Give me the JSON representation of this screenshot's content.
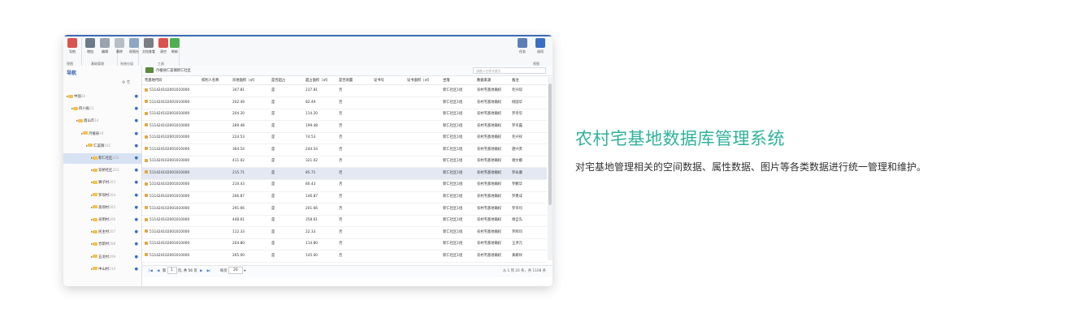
{
  "ribbon": {
    "buttons": [
      {
        "label": "导航",
        "color": "#d9534f"
      },
      {
        "label": "增加",
        "color": "#6c7a8c"
      },
      {
        "label": "编辑",
        "color": "#9aa3ad"
      },
      {
        "label": "删除",
        "color": "#b7bec6"
      },
      {
        "label": "权限社",
        "color": "#8ea6c4"
      },
      {
        "label": "文档查看",
        "color": "#7a7f86"
      },
      {
        "label": "清空",
        "color": "#d9534f"
      },
      {
        "label": "刷新",
        "color": "#4caf50"
      },
      {
        "label": "任务",
        "color": "#5b7fb5"
      },
      {
        "label": "选项",
        "color": "#3b6fc4"
      }
    ],
    "groups": [
      "视图",
      "基础管理",
      "系统分组",
      "工具",
      "视图"
    ]
  },
  "nav": {
    "title": "导航",
    "tree": [
      {
        "label": "中国",
        "count": "34",
        "depth": 0
      },
      {
        "label": "四川省",
        "count": "51",
        "depth": 1
      },
      {
        "label": "眉山市",
        "count": "14",
        "depth": 2
      },
      {
        "label": "丹棱县",
        "count": "24",
        "depth": 3
      },
      {
        "label": "仁美镇",
        "count": "102",
        "depth": 4
      },
      {
        "label": "新仁社区",
        "count": "202",
        "depth": 5,
        "selected": true
      },
      {
        "label": "双桥社区",
        "count": "203",
        "depth": 5
      },
      {
        "label": "狮子村",
        "count": "203",
        "depth": 5
      },
      {
        "label": "罗坝村",
        "count": "204",
        "depth": 5
      },
      {
        "label": "高坝村",
        "count": "205",
        "depth": 5
      },
      {
        "label": "光明村",
        "count": "206",
        "depth": 5
      },
      {
        "label": "民主村",
        "count": "207",
        "depth": 5
      },
      {
        "label": "合新村",
        "count": "208",
        "depth": 5
      },
      {
        "label": "五龙村",
        "count": "209",
        "depth": 5
      },
      {
        "label": "中山村",
        "count": "210",
        "depth": 5
      }
    ]
  },
  "tab": {
    "label": "丹棱县仁美镇新仁社区",
    "search_placeholder": "请输入名称关键字"
  },
  "grid": {
    "headers": [
      "宅基地代码",
      "权利人名称",
      "宗地面积（㎡）",
      "是否超占",
      "超占面积（㎡）",
      "是否闲置",
      "证书号",
      "证书面积（㎡）",
      "坐落",
      "数据来源",
      "备注"
    ],
    "rows": [
      {
        "code": "511424102001010000",
        "area": "347.81",
        "over": "是",
        "over_area": "237.81",
        "idle": "否",
        "loc": "新仁社区1组",
        "src": "农村宅基地确权",
        "note": "毛兴琼"
      },
      {
        "code": "511424102001010000",
        "area": "202.49",
        "over": "是",
        "over_area": "82.49",
        "idle": "否",
        "loc": "新仁社区1组",
        "src": "农村宅基地确权",
        "note": "杨国华"
      },
      {
        "code": "511424102001010000",
        "area": "204.20",
        "over": "是",
        "over_area": "114.20",
        "idle": "否",
        "loc": "新仁社区1组",
        "src": "农村宅基地确权",
        "note": "罗幸华"
      },
      {
        "code": "511424102001010000",
        "area": "289.48",
        "over": "是",
        "over_area": "199.48",
        "idle": "否",
        "loc": "新仁社区1组",
        "src": "农村宅基地确权",
        "note": "罗幸露"
      },
      {
        "code": "511424102001010000",
        "area": "224.53",
        "over": "是",
        "over_area": "74.53",
        "idle": "否",
        "loc": "新仁社区1组",
        "src": "农村宅基地确权",
        "note": "毛兴祥"
      },
      {
        "code": "511424102001010000",
        "area": "364.54",
        "over": "是",
        "over_area": "244.54",
        "idle": "否",
        "loc": "新仁社区1组",
        "src": "农村宅基地确权",
        "note": "唐兴贵"
      },
      {
        "code": "511424102001010000",
        "area": "411.02",
        "over": "是",
        "over_area": "321.02",
        "idle": "否",
        "loc": "新仁社区1组",
        "src": "农村宅基地确权",
        "note": "谢文娥"
      },
      {
        "code": "511424102001010000",
        "area": "215.71",
        "over": "是",
        "over_area": "85.71",
        "idle": "否",
        "loc": "新仁社区1组",
        "src": "农村宅基地确权",
        "note": "罗永康",
        "selected": true
      },
      {
        "code": "511424102001010000",
        "area": "210.43",
        "over": "是",
        "over_area": "80.43",
        "idle": "否",
        "loc": "新仁社区1组",
        "src": "农村宅基地确权",
        "note": "罗鹏华"
      },
      {
        "code": "511424102001010000",
        "area": "266.87",
        "over": "是",
        "over_area": "146.87",
        "idle": "否",
        "loc": "新仁社区1组",
        "src": "农村宅基地确权",
        "note": "罗勇成"
      },
      {
        "code": "511424102001010000",
        "area": "291.66",
        "over": "是",
        "over_area": "201.66",
        "idle": "否",
        "loc": "新仁社区1组",
        "src": "农村宅基地确权",
        "note": "罗幸均"
      },
      {
        "code": "511424102001010000",
        "area": "448.61",
        "over": "是",
        "over_area": "358.61",
        "idle": "否",
        "loc": "新仁社区1组",
        "src": "农村宅基地确权",
        "note": "谢自先"
      },
      {
        "code": "511424102001010000",
        "area": "112.33",
        "over": "是",
        "over_area": "22.33",
        "idle": "否",
        "loc": "新仁社区1组",
        "src": "农村宅基地确权",
        "note": "罗辉均"
      },
      {
        "code": "511424102001010000",
        "area": "204.80",
        "over": "是",
        "over_area": "114.80",
        "idle": "否",
        "loc": "新仁社区1组",
        "src": "农村宅基地确权",
        "note": "王洪元"
      },
      {
        "code": "511424102001010000",
        "area": "265.00",
        "over": "是",
        "over_area": "145.00",
        "idle": "否",
        "loc": "新仁社区1组",
        "src": "农村宅基地确权",
        "note": "黄耕祥"
      }
    ]
  },
  "pager": {
    "page": "1",
    "total_text": "页, 共 56 页",
    "page_size_label": "每页",
    "page_size": "20",
    "summary": "从 1 到 20 条，共 1108 条"
  },
  "heading": {
    "title": "农村宅基地数据库管理系统",
    "description": "对宅基地管理相关的空间数据、属性数据、图片等各类数据进行统一管理和维护。"
  },
  "colors": {
    "accent": "#2fb29a",
    "brand": "#3d6bb3"
  }
}
